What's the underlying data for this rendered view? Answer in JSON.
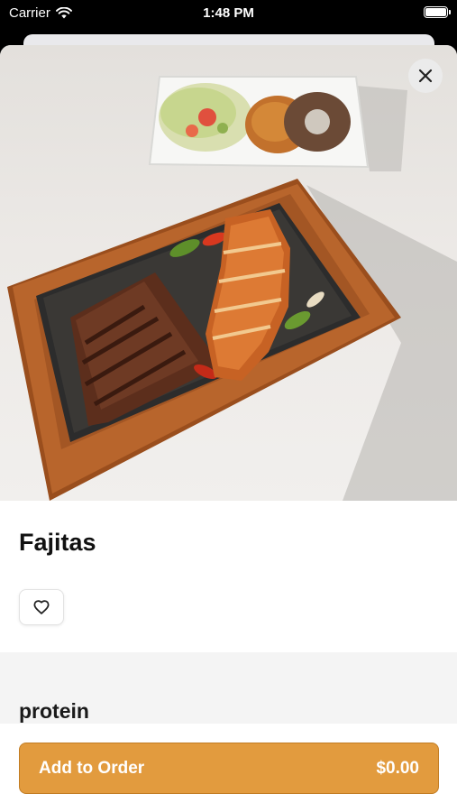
{
  "status_bar": {
    "carrier": "Carrier",
    "time": "1:48 PM"
  },
  "item": {
    "name": "Fajitas",
    "image_icon": "fajitas-photo",
    "close_icon": "close-icon",
    "favorite_icon": "heart-outline-icon"
  },
  "options": {
    "section_title": "protein"
  },
  "footer": {
    "button_label": "Add to Order",
    "price": "$0.00",
    "accent_color": "#e29b3e"
  }
}
